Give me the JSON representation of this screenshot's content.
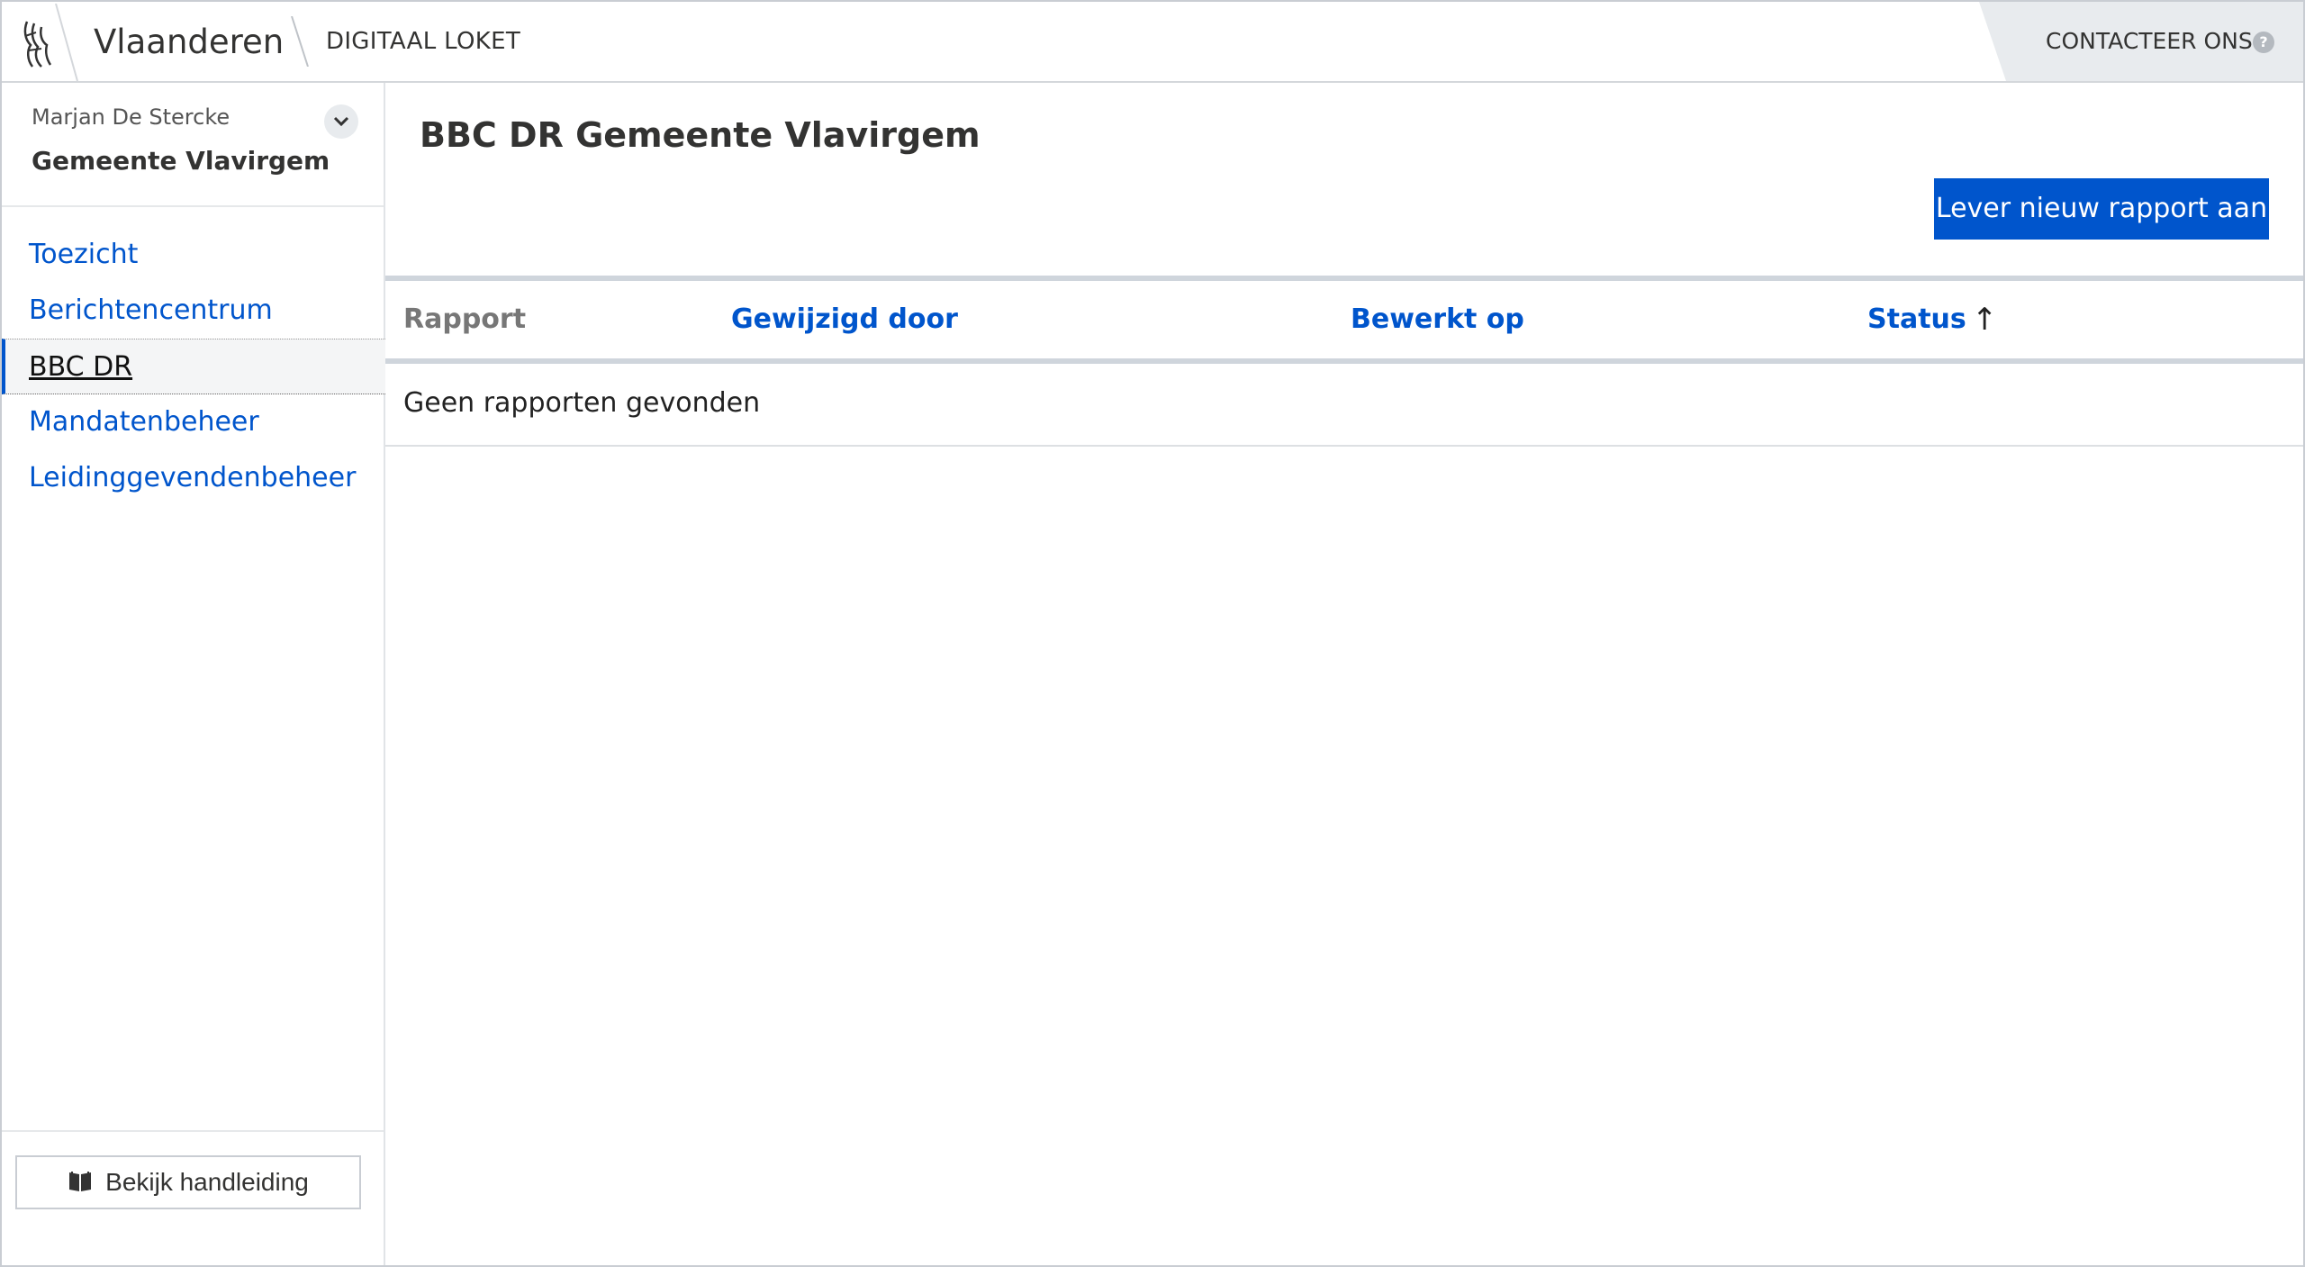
{
  "header": {
    "brand": "Vlaanderen",
    "app_name": "DIGITAAL LOKET",
    "contact_label": "CONTACTEER ONS",
    "help_glyph": "?",
    "icons": [
      "flanders-lion-icon",
      "help-circle-icon"
    ]
  },
  "sidebar": {
    "user_name": "Marjan De Stercke",
    "organisation": "Gemeente Vlavirgem",
    "items": [
      {
        "label": "Toezicht",
        "active": false
      },
      {
        "label": "Berichtencentrum",
        "active": false
      },
      {
        "label": "BBC DR",
        "active": true
      },
      {
        "label": "Mandatenbeheer",
        "active": false
      },
      {
        "label": "Leidinggevendenbeheer",
        "active": false
      }
    ],
    "manual_button": "Bekijk handleiding"
  },
  "main": {
    "title": "BBC DR Gemeente Vlavirgem",
    "new_report_button": "Lever nieuw rapport aan",
    "table": {
      "columns": [
        "Rapport",
        "Gewijzigd door",
        "Bewerkt op",
        "Status"
      ],
      "sort_column": "Status",
      "sort_direction": "ascending",
      "sort_glyph": "↑",
      "empty_message": "Geen rapporten gevonden"
    }
  },
  "colors": {
    "accent": "#0055cc",
    "header_contact_bg": "#e8ebee",
    "text": "#333332"
  }
}
